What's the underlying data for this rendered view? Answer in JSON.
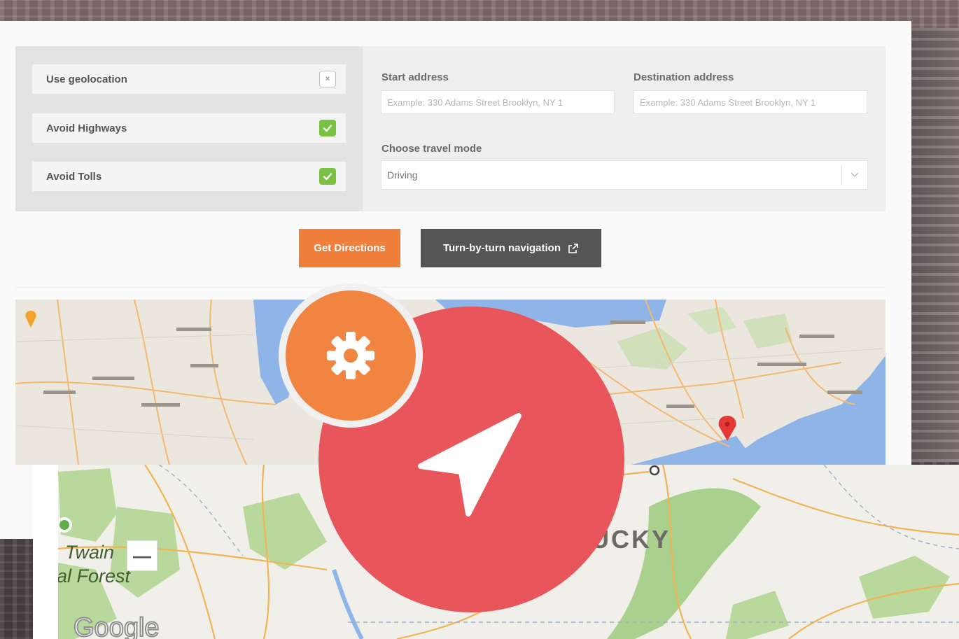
{
  "options": [
    {
      "label": "Use geolocation",
      "checked": false,
      "mark": "×"
    },
    {
      "label": "Avoid Highways",
      "checked": true
    },
    {
      "label": "Avoid Tolls",
      "checked": true
    }
  ],
  "start": {
    "label": "Start address",
    "placeholder": "Example: 330 Adams Street Brooklyn, NY 1"
  },
  "destination": {
    "label": "Destination address",
    "placeholder": "Example: 330 Adams Street Brooklyn, NY 1"
  },
  "travel_mode": {
    "label": "Choose travel mode",
    "value": "Driving"
  },
  "buttons": {
    "get_directions": "Get Directions",
    "turn_by_turn": "Turn-by-turn navigation"
  },
  "map": {
    "region_label": "TUCKY",
    "forest_label_1": "Twain",
    "forest_label_2": "al Forest",
    "zoom_out": "—",
    "attribution": "Google"
  },
  "colors": {
    "accent_orange": "#f07f3c",
    "dark_button": "#555555",
    "check_green": "#7ac143",
    "nav_red": "#e8555a"
  },
  "icons": [
    "gear-icon",
    "navigation-arrow-icon",
    "external-link-icon",
    "map-pin-icon",
    "checkmark-icon"
  ]
}
